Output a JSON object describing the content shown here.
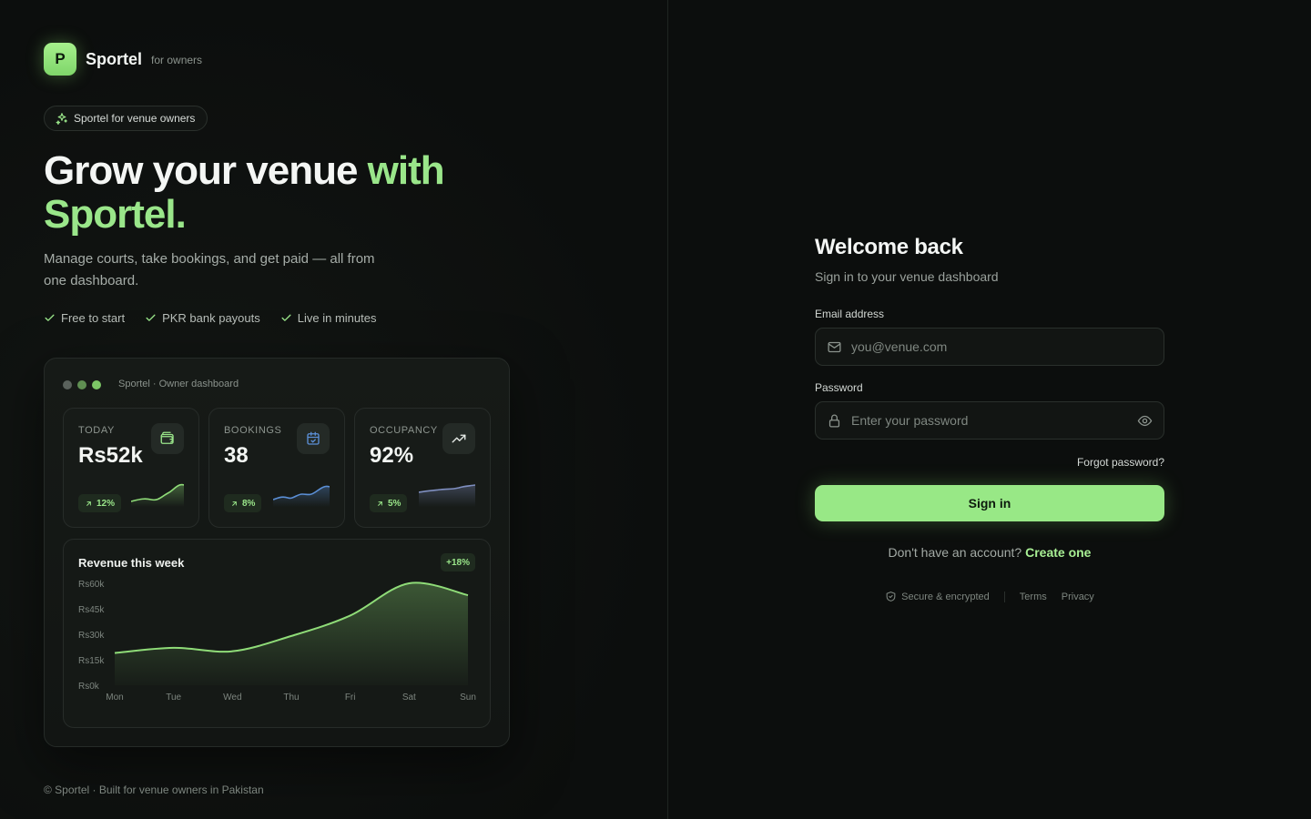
{
  "brand": {
    "logo_letter": "P",
    "name": "Sportel",
    "tagline": "for owners"
  },
  "badge": {
    "label": "Sportel for venue owners"
  },
  "hero": {
    "headline_main": "Grow your venue ",
    "headline_accent_1": "with",
    "headline_accent_2": "Sportel.",
    "subtext": "Manage courts, take bookings, and get paid — all from one dashboard."
  },
  "features": [
    "Free to start",
    "PKR bank payouts",
    "Live in minutes"
  ],
  "dashboard": {
    "window_title": "Sportel · Owner dashboard",
    "stats": [
      {
        "label": "TODAY",
        "value": "Rs52k",
        "delta": "12%",
        "icon": "wallet-icon"
      },
      {
        "label": "BOOKINGS",
        "value": "38",
        "delta": "8%",
        "icon": "calendar-check-icon"
      },
      {
        "label": "OCCUPANCY",
        "value": "92%",
        "delta": "5%",
        "icon": "trending-up-icon"
      }
    ],
    "revenue": {
      "title": "Revenue this week",
      "delta": "+18%"
    }
  },
  "chart_data": {
    "type": "area",
    "title": "Revenue this week",
    "categories": [
      "Mon",
      "Tue",
      "Wed",
      "Thu",
      "Fri",
      "Sat",
      "Sun"
    ],
    "y_ticks": [
      "Rs60k",
      "Rs45k",
      "Rs30k",
      "Rs15k",
      "Rs0k"
    ],
    "ylim": [
      0,
      60
    ],
    "values": [
      19,
      22,
      20,
      29,
      41,
      60,
      53
    ],
    "color": "#8fdc78"
  },
  "footer_left": "© Sportel · Built for venue owners in Pakistan",
  "login": {
    "title": "Welcome back",
    "subtitle": "Sign in to your venue dashboard",
    "email_label": "Email address",
    "email_placeholder": "you@venue.com",
    "password_label": "Password",
    "password_placeholder": "Enter your password",
    "forgot": "Forgot password?",
    "signin": "Sign in",
    "no_account": "Don't have an account? ",
    "create": "Create one",
    "secure": "Secure & encrypted",
    "terms": "Terms",
    "privacy": "Privacy"
  },
  "colors": {
    "accent": "#98e886",
    "background": "#0c0e0d",
    "blue": "#5b8fd6"
  }
}
